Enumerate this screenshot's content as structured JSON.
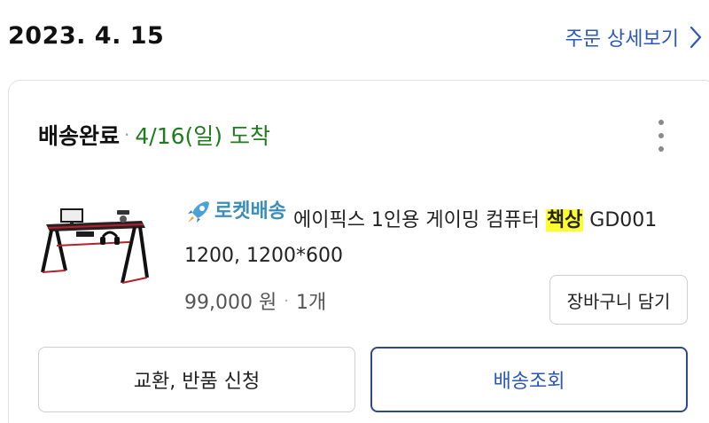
{
  "order": {
    "date": "2023. 4. 15",
    "detail_link_label": "주문 상세보기"
  },
  "delivery": {
    "status": "배송완료",
    "separator": "·",
    "arrival": "4/16(일) 도착"
  },
  "product": {
    "badge_label": "로켓배송",
    "name_before": "에이픽스 1인용 게이밍 컴퓨터 ",
    "name_highlight": "책상",
    "name_after": " GD001 1200, 1200*600",
    "price": "99,000 원",
    "separator": "·",
    "quantity": "1개",
    "icons": {
      "badge": "rocket-icon",
      "thumbnail": "gaming-desk-image"
    }
  },
  "actions": {
    "add_to_cart": "장바구니 담기",
    "exchange_return": "교환, 반품 신청",
    "track_delivery": "배송조회"
  },
  "colors": {
    "link": "#2a58b8",
    "arrival": "#1e7b1e",
    "rocket": "#3a8fb8",
    "highlight": "#ffff2e",
    "primary_border": "#2e4a8a"
  }
}
